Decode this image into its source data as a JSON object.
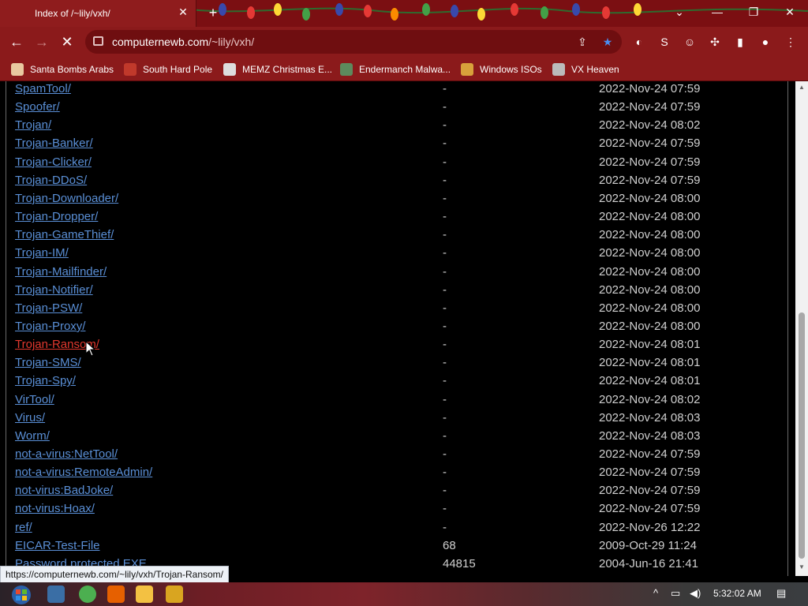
{
  "browser": {
    "tab_title": "Index of /~lily/vxh/",
    "tab_close": "✕",
    "new_tab": "+",
    "url_host": "computernewb.com",
    "url_path": "/~lily/vxh/",
    "status_url": "https://computernewb.com/~lily/vxh/Trojan-Ransom/"
  },
  "bookmarks": [
    {
      "label": "Santa Bombs Arabs",
      "icon": "santa-icon",
      "color": "#e9c8a0"
    },
    {
      "label": "South Hard Pole",
      "icon": "snowflake-icon",
      "color": "#c0392b"
    },
    {
      "label": "MEMZ Christmas E...",
      "icon": "memz-icon",
      "color": "#dddddd"
    },
    {
      "label": "Endermanch Malwa...",
      "icon": "cat-icon",
      "color": "#5d8a5d"
    },
    {
      "label": "Windows ISOs",
      "icon": "person-icon",
      "color": "#d8a13b"
    },
    {
      "label": "VX Heaven",
      "icon": "skull-icon",
      "color": "#bbbbbb"
    }
  ],
  "listing": [
    {
      "name": "SpamTool/",
      "size": "-",
      "date": "2022-Nov-24 07:59"
    },
    {
      "name": "Spoofer/",
      "size": "-",
      "date": "2022-Nov-24 07:59"
    },
    {
      "name": "Trojan/",
      "size": "-",
      "date": "2022-Nov-24 08:02"
    },
    {
      "name": "Trojan-Banker/",
      "size": "-",
      "date": "2022-Nov-24 07:59"
    },
    {
      "name": "Trojan-Clicker/",
      "size": "-",
      "date": "2022-Nov-24 07:59"
    },
    {
      "name": "Trojan-DDoS/",
      "size": "-",
      "date": "2022-Nov-24 07:59"
    },
    {
      "name": "Trojan-Downloader/",
      "size": "-",
      "date": "2022-Nov-24 08:00"
    },
    {
      "name": "Trojan-Dropper/",
      "size": "-",
      "date": "2022-Nov-24 08:00"
    },
    {
      "name": "Trojan-GameThief/",
      "size": "-",
      "date": "2022-Nov-24 08:00"
    },
    {
      "name": "Trojan-IM/",
      "size": "-",
      "date": "2022-Nov-24 08:00"
    },
    {
      "name": "Trojan-Mailfinder/",
      "size": "-",
      "date": "2022-Nov-24 08:00"
    },
    {
      "name": "Trojan-Notifier/",
      "size": "-",
      "date": "2022-Nov-24 08:00"
    },
    {
      "name": "Trojan-PSW/",
      "size": "-",
      "date": "2022-Nov-24 08:00"
    },
    {
      "name": "Trojan-Proxy/",
      "size": "-",
      "date": "2022-Nov-24 08:00"
    },
    {
      "name": "Trojan-Ransom/",
      "size": "-",
      "date": "2022-Nov-24 08:01",
      "hover": true
    },
    {
      "name": "Trojan-SMS/",
      "size": "-",
      "date": "2022-Nov-24 08:01"
    },
    {
      "name": "Trojan-Spy/",
      "size": "-",
      "date": "2022-Nov-24 08:01"
    },
    {
      "name": "VirTool/",
      "size": "-",
      "date": "2022-Nov-24 08:02"
    },
    {
      "name": "Virus/",
      "size": "-",
      "date": "2022-Nov-24 08:03"
    },
    {
      "name": "Worm/",
      "size": "-",
      "date": "2022-Nov-24 08:03"
    },
    {
      "name": "not-a-virus:NetTool/",
      "size": "-",
      "date": "2022-Nov-24 07:59"
    },
    {
      "name": "not-a-virus:RemoteAdmin/",
      "size": "-",
      "date": "2022-Nov-24 07:59"
    },
    {
      "name": "not-virus:BadJoke/",
      "size": "-",
      "date": "2022-Nov-24 07:59"
    },
    {
      "name": "not-virus:Hoax/",
      "size": "-",
      "date": "2022-Nov-24 07:59"
    },
    {
      "name": "ref/",
      "size": "-",
      "date": "2022-Nov-26 12:22"
    },
    {
      "name": "EICAR-Test-File",
      "size": "68",
      "date": "2009-Oct-29 11:24"
    },
    {
      "name": "Password protected.EXE",
      "size": "44815",
      "date": "2004-Jun-16 21:41"
    }
  ],
  "taskbar": {
    "clock": "5:32:02 AM",
    "apps": [
      {
        "icon": "task-view-icon",
        "color": "#3a6ea5"
      },
      {
        "icon": "chrome-icon",
        "color": "#4caf50"
      },
      {
        "icon": "firefox-icon",
        "color": "#e66000"
      },
      {
        "icon": "file-explorer-icon",
        "color": "#f3c142"
      },
      {
        "icon": "app-icon",
        "color": "#d9a520"
      }
    ]
  },
  "colors": {
    "link": "#5a8fd6",
    "link_hover": "#e2382e",
    "chrome_bg": "#8b1a1b"
  }
}
